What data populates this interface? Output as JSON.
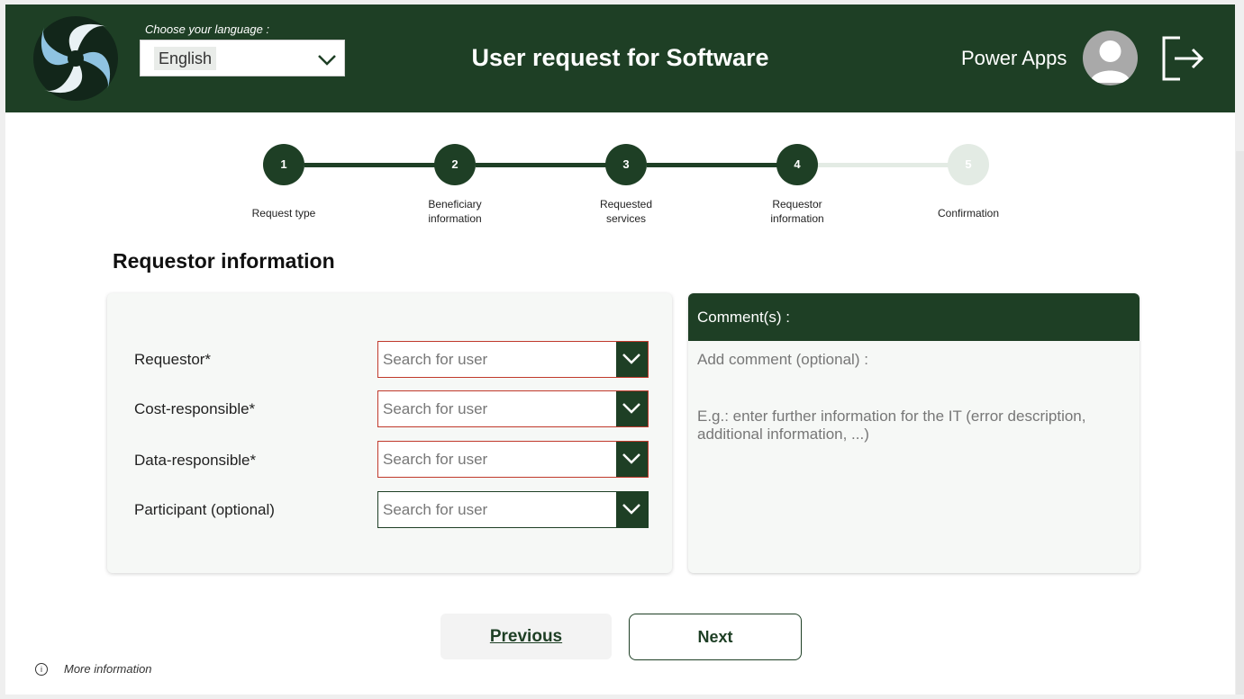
{
  "header": {
    "language_label": "Choose your language :",
    "language_value": "English",
    "title": "User request for Software",
    "brand": "Power Apps",
    "logo_icon": "company-logo-swirl",
    "avatar_icon": "user-avatar-icon",
    "logout_icon": "sign-out-icon",
    "background_color": "#1e3f25"
  },
  "stepper": {
    "current_step": 4,
    "steps": [
      {
        "number": "1",
        "label": "Request type"
      },
      {
        "number": "2",
        "label": "Beneficiary\ninformation"
      },
      {
        "number": "3",
        "label": "Requested\nservices"
      },
      {
        "number": "4",
        "label": "Requestor\ninformation"
      },
      {
        "number": "5",
        "label": "Confirmation"
      }
    ]
  },
  "section_title": "Requestor information",
  "form": {
    "fields": [
      {
        "label": "Requestor*",
        "placeholder": "Search for user",
        "required": true
      },
      {
        "label": "Cost-responsible*",
        "placeholder": "Search for user",
        "required": true
      },
      {
        "label": "Data-responsible*",
        "placeholder": "Search for user",
        "required": true
      },
      {
        "label": "Participant (optional)",
        "placeholder": "Search for user",
        "required": false
      }
    ]
  },
  "comments": {
    "header": "Comment(s) :",
    "label": "Add comment (optional) :",
    "placeholder": "E.g.: enter further information for the IT (error description, additional information, ...)"
  },
  "nav": {
    "previous_label": "Previous",
    "next_label": "Next"
  },
  "footer": {
    "more_info": "More information",
    "info_icon_char": "i"
  }
}
